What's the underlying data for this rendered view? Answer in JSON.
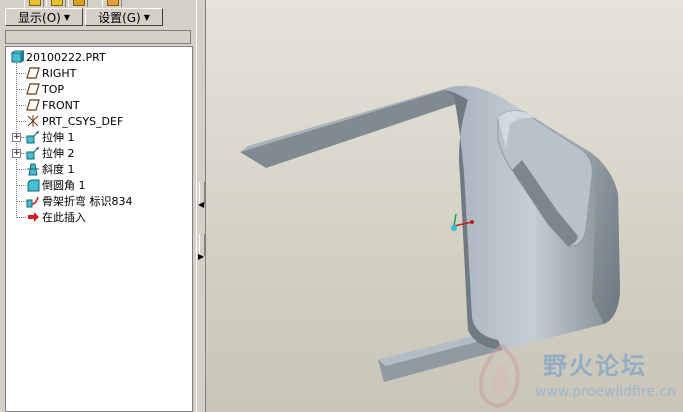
{
  "toolbar": {
    "show_menu": "显示(O)",
    "settings_menu": "设置(G)"
  },
  "model_tree": {
    "root": "20100222.PRT",
    "items": [
      {
        "label": "RIGHT",
        "icon": "datum-plane-icon"
      },
      {
        "label": "TOP",
        "icon": "datum-plane-icon"
      },
      {
        "label": "FRONT",
        "icon": "datum-plane-icon"
      },
      {
        "label": "PRT_CSYS_DEF",
        "icon": "coordinate-system-icon"
      },
      {
        "label": "拉伸 1",
        "icon": "extrude-icon",
        "expandable": true
      },
      {
        "label": "拉伸 2",
        "icon": "extrude-icon",
        "expandable": true
      },
      {
        "label": "斜度 1",
        "icon": "draft-icon"
      },
      {
        "label": "倒圆角 1",
        "icon": "round-icon"
      },
      {
        "label": "骨架折弯 标识834",
        "icon": "spinal-bend-icon"
      },
      {
        "label": "在此插入",
        "icon": "insert-here-icon"
      }
    ]
  },
  "watermark": {
    "title": "野火论坛",
    "url": "www.proewildfire.cn"
  },
  "colors": {
    "viewport_bg": "#d8d5ca",
    "part_fill": "#8e9aa4",
    "tree_bg": "#ffffff",
    "chrome": "#d4d0c8"
  }
}
